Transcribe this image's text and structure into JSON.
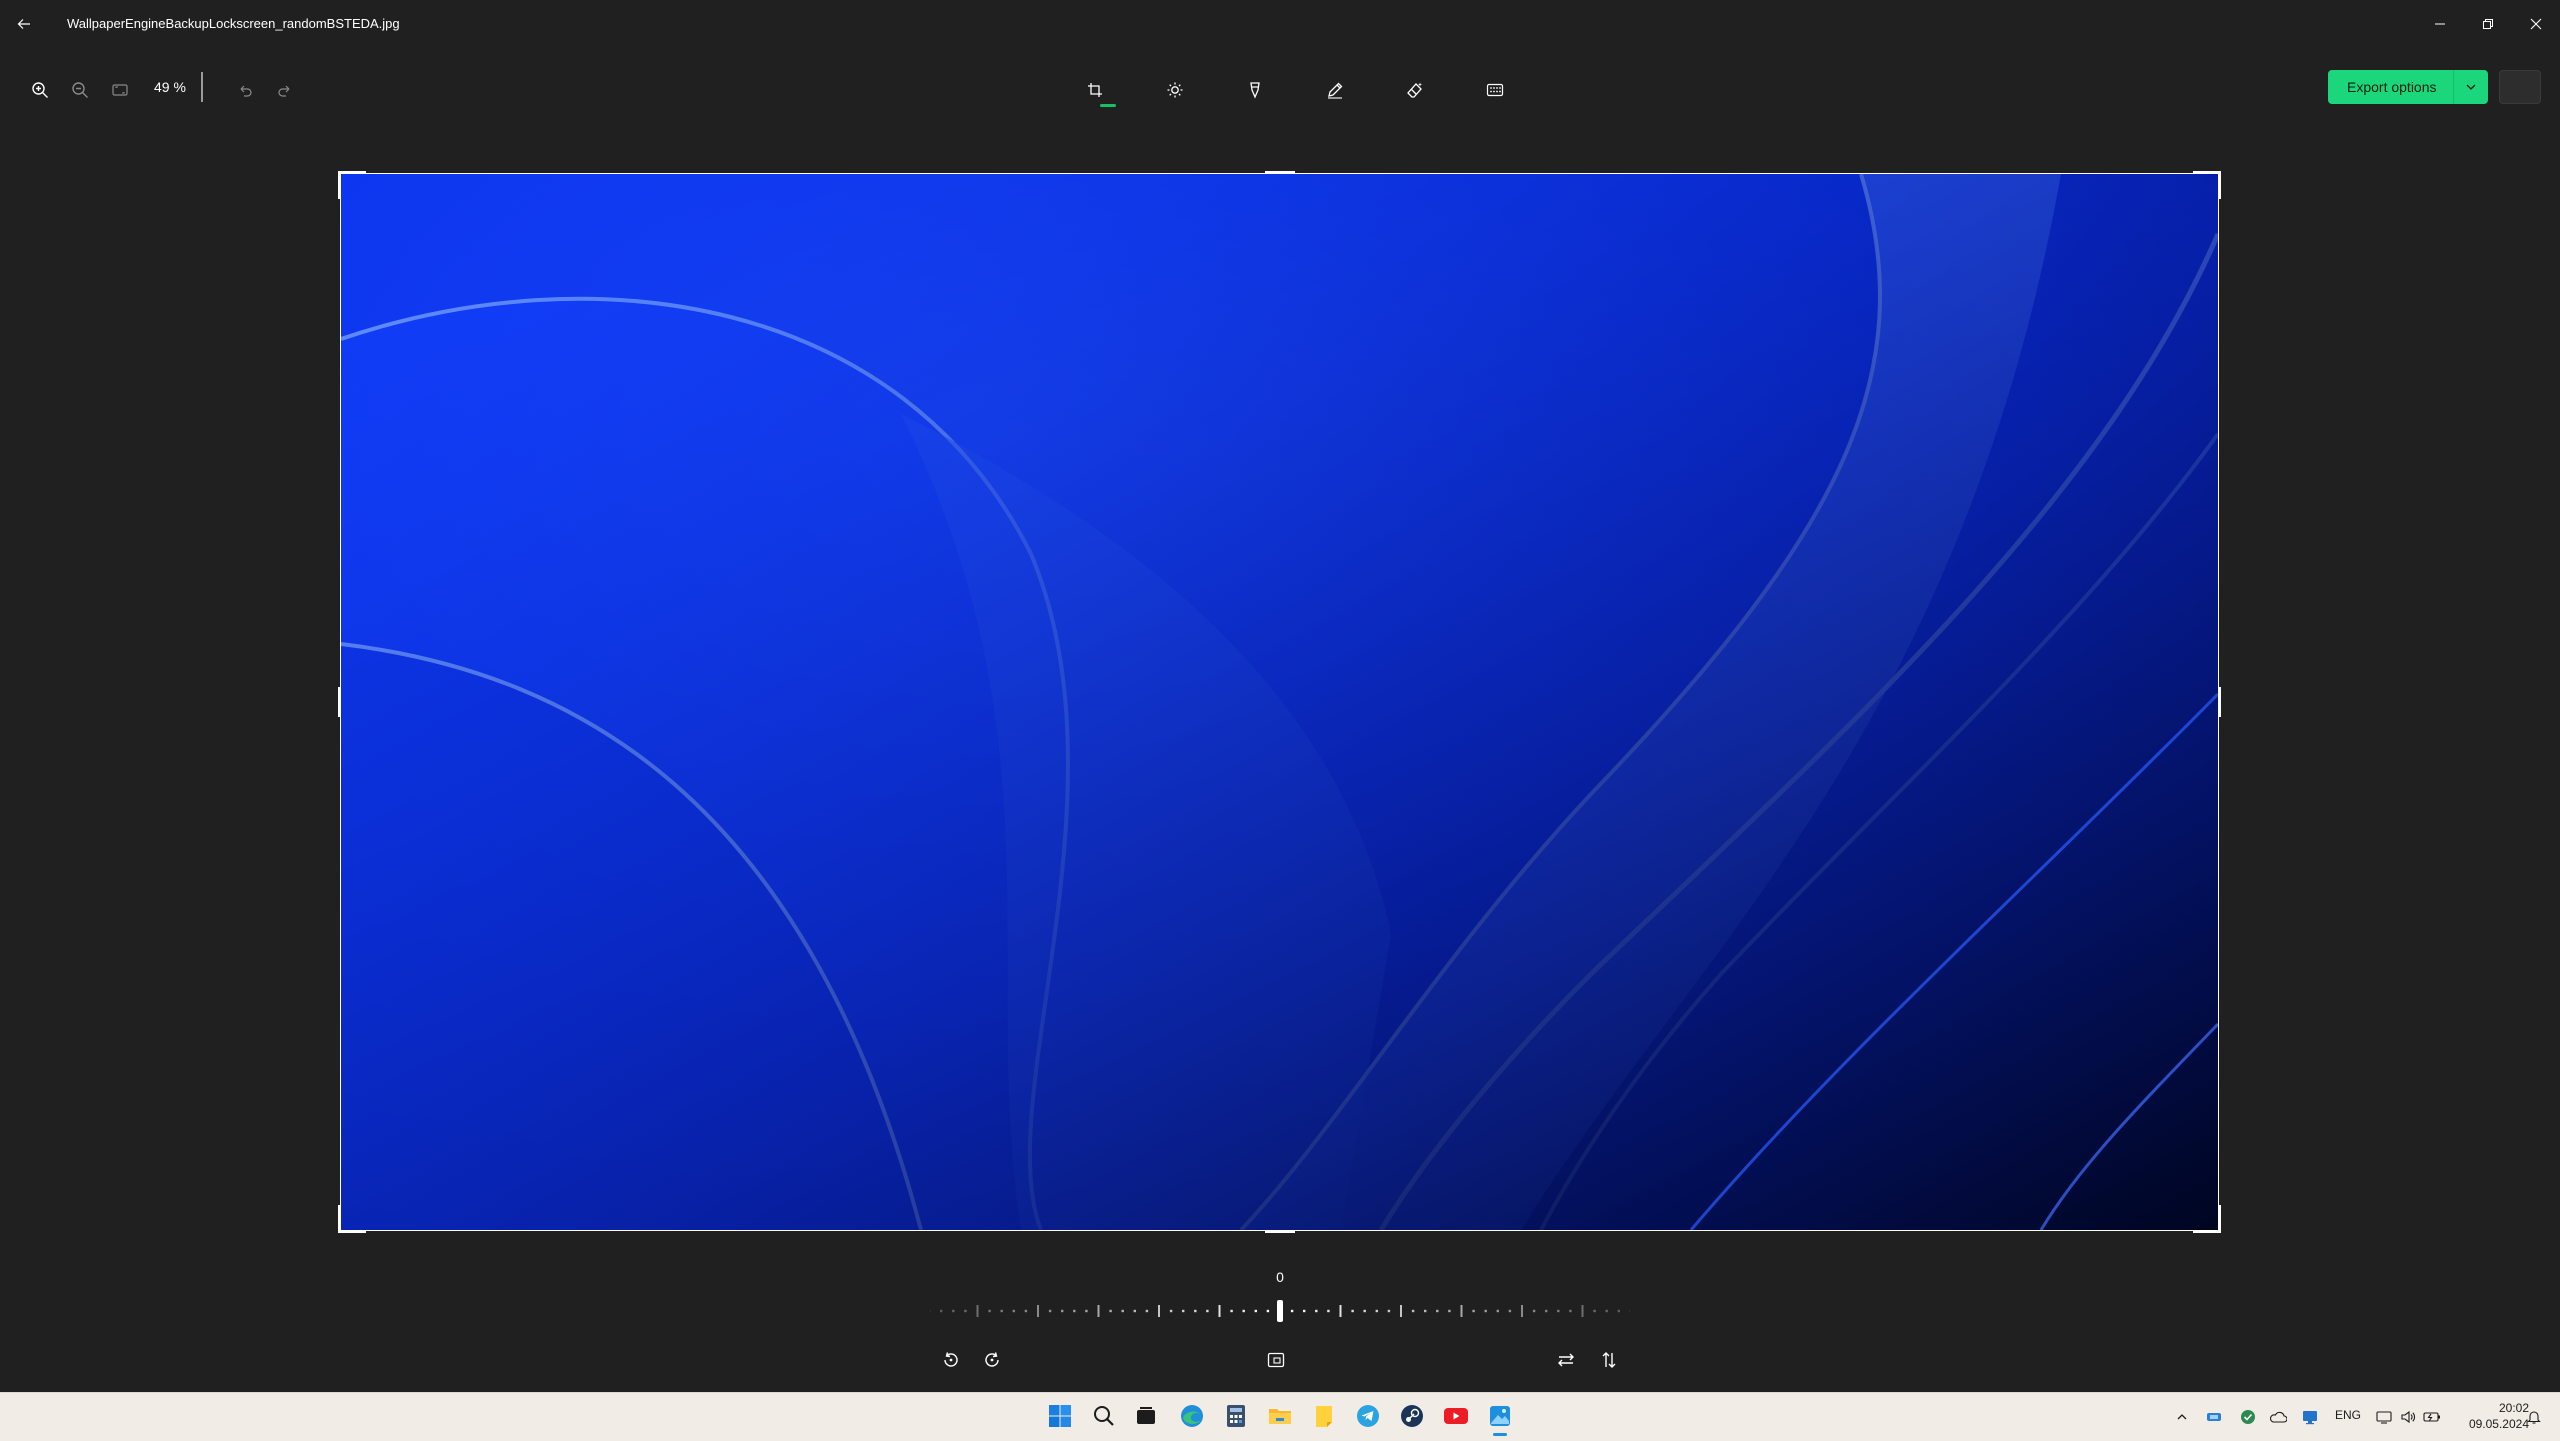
{
  "window": {
    "title": "WallpaperEngineBackupLockscreen_randomBSTEDA.jpg",
    "icons": [
      "back-icon",
      "minimize-icon",
      "maximize-icon",
      "close-icon"
    ]
  },
  "toolbar": {
    "zoom_value": "49 %",
    "left_tools": [
      "zoom-in-icon",
      "zoom-out-icon",
      "fit-to-window-icon",
      "undo-icon",
      "redo-icon"
    ],
    "edit_tools": [
      {
        "name": "crop-icon",
        "active": true
      },
      {
        "name": "adjust-icon",
        "active": false
      },
      {
        "name": "filter-icon",
        "active": false
      },
      {
        "name": "markup-icon",
        "active": false
      },
      {
        "name": "erase-icon",
        "active": false
      },
      {
        "name": "background-blur-icon",
        "active": false
      }
    ],
    "export_label": "Export options",
    "export_color": "#1bd67b",
    "active_underline_color": "#16c260"
  },
  "crop": {
    "angle_value": "0",
    "controls": [
      "rotate-left-icon",
      "rotate-right-icon",
      "aspect-ratio-icon",
      "flip-horizontal-icon",
      "flip-vertical-icon"
    ]
  },
  "image": {
    "description_colors": [
      "#0a35f5",
      "#0b2fd8",
      "#000a3a"
    ]
  },
  "taskbar": {
    "apps": [
      "start-icon",
      "search-icon",
      "task-view-icon",
      "edge-icon",
      "calculator-icon",
      "file-explorer-icon",
      "sticky-notes-icon",
      "telegram-icon",
      "steam-icon",
      "youtube-icon",
      "photos-icon"
    ],
    "tray_icons": [
      "chevron-up-icon",
      "bluetooth-icon",
      "shield-icon",
      "onedrive-icon",
      "display-icon",
      "network-icon",
      "volume-icon",
      "battery-icon",
      "notification-icon"
    ],
    "language": "ENG",
    "time": "20:02",
    "date": "09.05.2024"
  }
}
